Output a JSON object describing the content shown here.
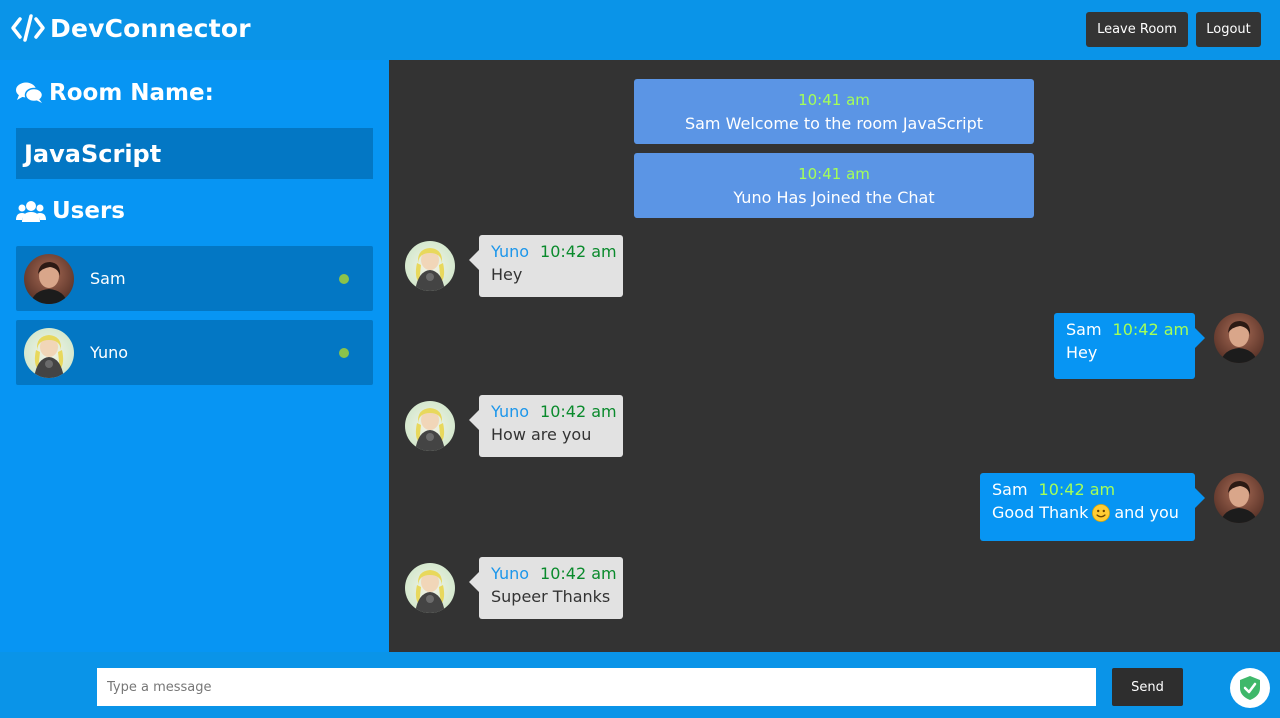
{
  "app": {
    "title": "DevConnector",
    "logo_icon": "code-icon"
  },
  "header": {
    "leave_room_label": "Leave Room",
    "logout_label": "Logout"
  },
  "sidebar": {
    "room_heading": "Room Name:",
    "room_name": "JavaScript",
    "users_heading": "Users",
    "users": [
      {
        "name": "Sam",
        "status": "online"
      },
      {
        "name": "Yuno",
        "status": "online"
      }
    ]
  },
  "chat": {
    "system_messages": [
      {
        "time": "10:41 am",
        "text": "Sam Welcome to the room JavaScript"
      },
      {
        "time": "10:41 am",
        "text": "Yuno Has Joined the Chat"
      }
    ],
    "messages": [
      {
        "sender": "Yuno",
        "time": "10:42 am",
        "text": "Hey",
        "direction": "in"
      },
      {
        "sender": "Sam",
        "time": "10:42 am",
        "text": "Hey",
        "direction": "out"
      },
      {
        "sender": "Yuno",
        "time": "10:42 am",
        "text": "How are you",
        "direction": "in"
      },
      {
        "sender": "Sam",
        "time": "10:42 am",
        "text_before": "Good Thank",
        "emoji": "smiley-emoji",
        "text_after": "and you",
        "direction": "out"
      },
      {
        "sender": "Yuno",
        "time": "10:42 am",
        "text": "Supeer Thanks",
        "direction": "in"
      }
    ]
  },
  "footer": {
    "input_placeholder": "Type a message",
    "input_value": "",
    "send_label": "Send",
    "badge_icon": "shield-check-icon"
  },
  "colors": {
    "primary": "#0a94e8",
    "sidebar_item": "#0377c4",
    "chat_bg": "#333333",
    "system_bubble": "#5b95e5",
    "online": "#8bc34a",
    "time_green": "#a5ff57"
  }
}
